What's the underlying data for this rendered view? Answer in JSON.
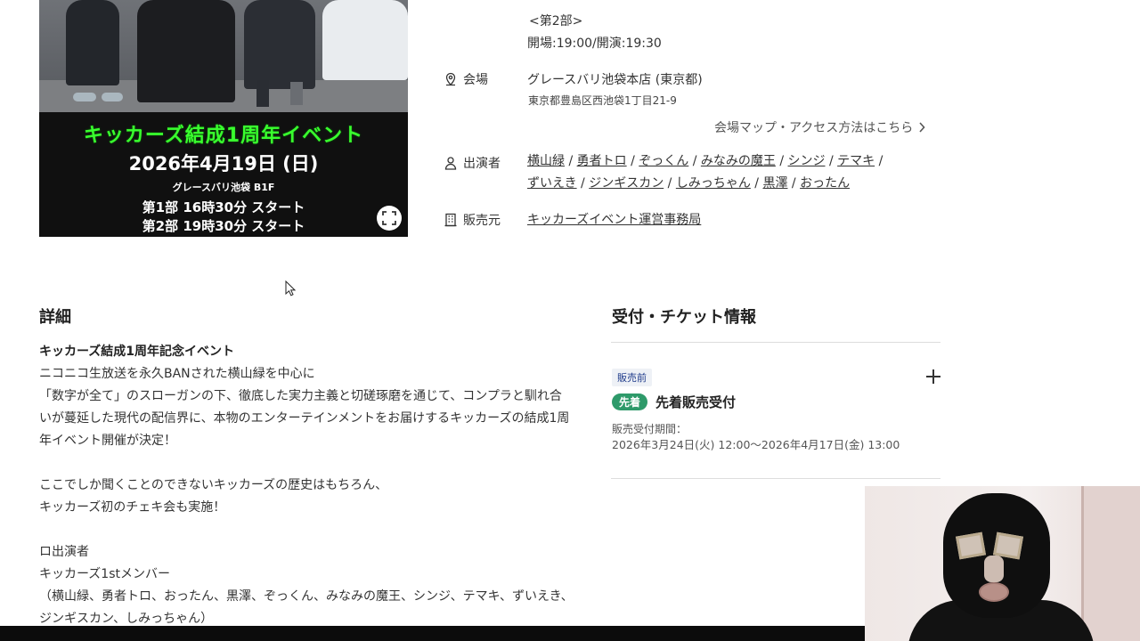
{
  "poster": {
    "headline": "キッカーズ結成1周年イベント",
    "date": "2026年4月19日 (日)",
    "venue": "グレースバリ池袋 B1F",
    "part1": "第1部 16時30分 スタート",
    "part2": "第2部 19時30分 スタート"
  },
  "schedule": {
    "part_label": "<第2部>",
    "times": "開場:19:00/開演:19:30"
  },
  "venue": {
    "label": "会場",
    "name": "グレースバリ池袋本店 (東京都)",
    "address": "東京都豊島区西池袋1丁目21-9",
    "access_link": "会場マップ・アクセス方法はこちら"
  },
  "performers": {
    "label": "出演者",
    "list": [
      "横山緑",
      "勇者トロ",
      "ぞっくん",
      "みなみの魔王",
      "シンジ",
      "テマキ",
      "ずいえき",
      "ジンギスカン",
      "しみっちゃん",
      "黒澤",
      "おったん"
    ]
  },
  "seller": {
    "label": "販売元",
    "name": "キッカーズイベント運営事務局"
  },
  "details": {
    "title": "詳細",
    "lead": "キッカーズ結成1周年記念イベント",
    "body": "ニコニコ生放送を永久BANされた横山緑を中心に\n「数字が全て」のスローガンの下、徹底した実力主義と切磋琢磨を通じて、コンプラと馴れ合いが蔓延した現代の配信界に、本物のエンターテインメントをお届けするキッカーズの結成1周年イベント開催が決定！\n\nここでしか聞くことのできないキッカーズの歴史はもちろん、\nキッカーズ初のチェキ会も実施！\n\nロ出演者\nキッカーズ1stメンバー\n（横山緑、勇者トロ、おったん、黒澤、ぞっくん、みなみの魔王、シンジ、テマキ、ずいえき、ジンギスカン、しみっちゃん）"
  },
  "tickets": {
    "title": "受付・チケット情報",
    "status_badge": "販売前",
    "type_badge": "先着",
    "name": "先着販売受付",
    "period_label": "販売受付期間：",
    "period_value": "2026年3月24日(火) 12:00〜2026年4月17日(金) 13:00"
  },
  "colors": {
    "poster_green": "#39ff2e",
    "badge_first": "#2e9a6a",
    "badge_pre_text": "#1e3a8a"
  }
}
